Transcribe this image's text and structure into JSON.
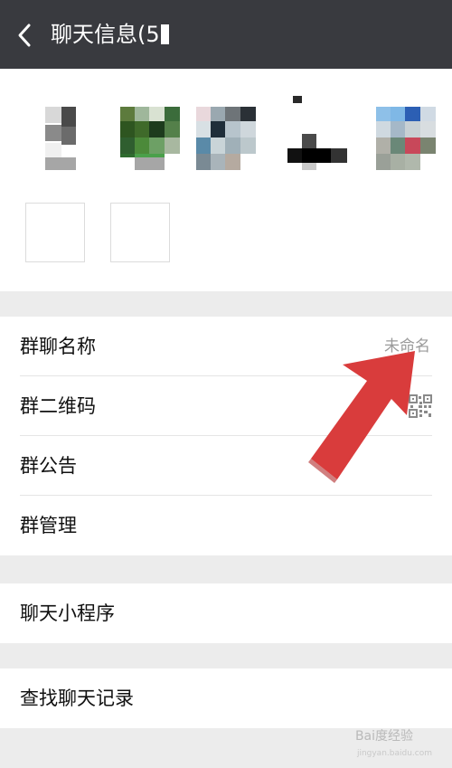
{
  "header": {
    "title": "聊天信息(5",
    "back_icon": "chevron-left-icon"
  },
  "members": {
    "count": 5,
    "add_icon": "plus-icon",
    "remove_icon": "minus-icon"
  },
  "settings": {
    "group_name": {
      "label": "群聊名称",
      "value": "未命名"
    },
    "qr_code": {
      "label": "群二维码",
      "icon": "qr-code-icon"
    },
    "announcement": {
      "label": "群公告"
    },
    "manage": {
      "label": "群管理"
    }
  },
  "mini_programs": {
    "label": "聊天小程序"
  },
  "search_history": {
    "label": "查找聊天记录"
  },
  "watermark": {
    "text": "Bai度经验",
    "sub": "jingyan.baidu.com"
  },
  "colors": {
    "header_bg": "#393a3f",
    "page_bg": "#ececec",
    "arrow": "#d93c3c"
  }
}
